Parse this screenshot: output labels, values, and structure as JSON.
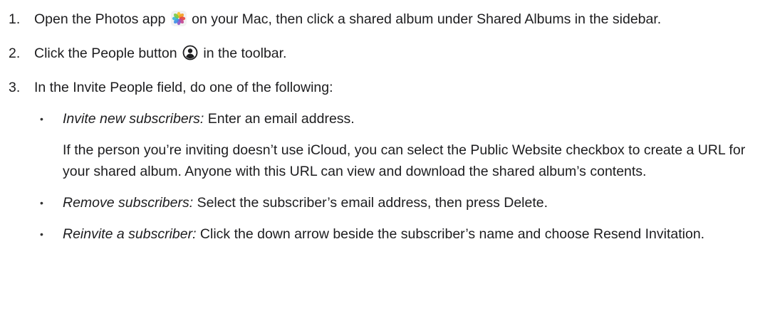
{
  "steps": [
    {
      "number": "1.",
      "text_before_icon": "Open the Photos app",
      "icon": "photos-app-icon",
      "text_after_icon": "on your Mac, then click a shared album under Shared Albums in the sidebar."
    },
    {
      "number": "2.",
      "text_before_icon": "Click the People button",
      "icon": "people-button-icon",
      "text_after_icon": "in the toolbar."
    },
    {
      "number": "3.",
      "text": "In the Invite People field, do one of the following:",
      "bullets": [
        {
          "marker": "•",
          "label": "Invite new subscribers:",
          "text": "Enter an email address.",
          "note": "If the person you’re inviting doesn’t use iCloud, you can select the Public Website checkbox to create a URL for your shared album. Anyone with this URL can view and download the shared album’s contents."
        },
        {
          "marker": "•",
          "label": "Remove subscribers:",
          "text": "Select the subscriber’s email address, then press Delete."
        },
        {
          "marker": "•",
          "label": "Reinvite a subscriber:",
          "text": "Click the down arrow beside the subscriber’s name and choose Resend Invitation."
        }
      ]
    }
  ]
}
